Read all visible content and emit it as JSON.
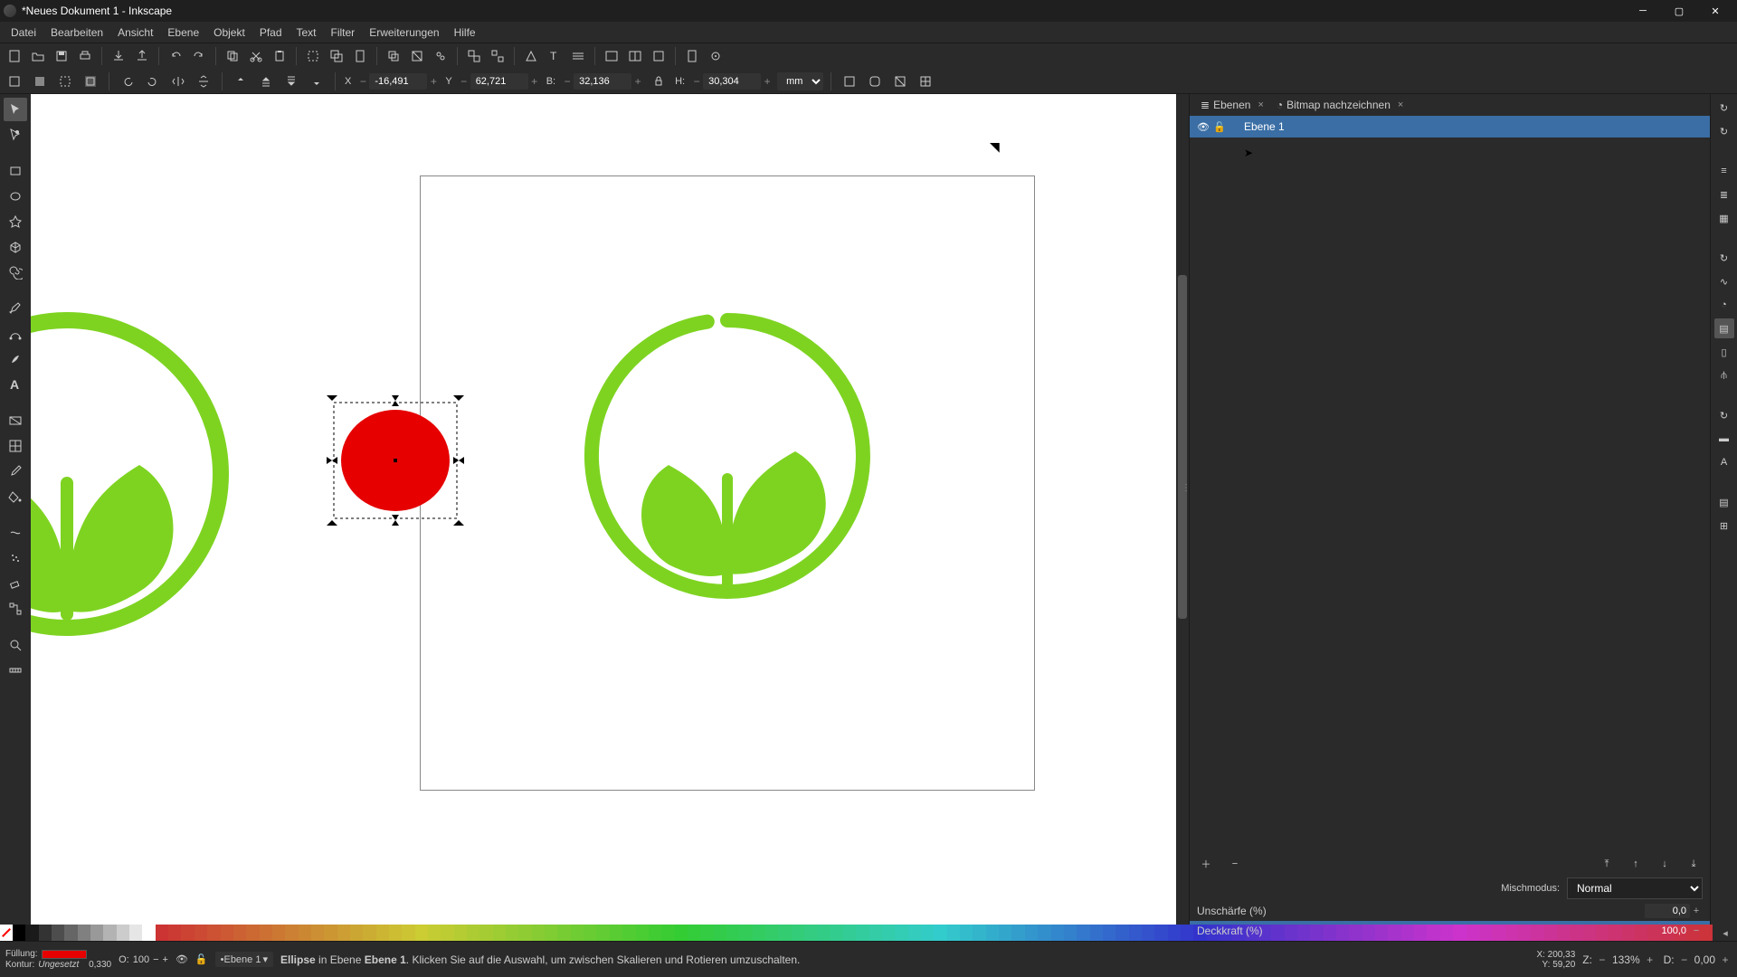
{
  "window": {
    "title": "*Neues Dokument 1 - Inkscape"
  },
  "menu": [
    "Datei",
    "Bearbeiten",
    "Ansicht",
    "Ebene",
    "Objekt",
    "Pfad",
    "Text",
    "Filter",
    "Erweiterungen",
    "Hilfe"
  ],
  "toolopts": {
    "x_label": "X",
    "x": "-16,491",
    "y_label": "Y",
    "y": "62,721",
    "w_label": "B:",
    "w": "32,136",
    "h_label": "H:",
    "h": "30,304",
    "unit": "mm"
  },
  "panels": {
    "tab1": "Ebenen",
    "tab2": "Bitmap nachzeichnen",
    "layer_name": "Ebene 1",
    "blend_label": "Mischmodus:",
    "blend_value": "Normal",
    "blur_label": "Unschärfe (%)",
    "blur_value": "0,0",
    "opacity_label": "Deckkraft (%)",
    "opacity_value": "100,0"
  },
  "status": {
    "fill_label": "Füllung:",
    "stroke_label": "Kontur:",
    "stroke_val": "Ungesetzt",
    "stroke_extra": "0,330",
    "o_label": "O:",
    "o_value": "100",
    "layer_indicator": "•Ebene 1",
    "selection_type": "Ellipse",
    "hint_prefix": "in Ebene",
    "hint_layer": "Ebene 1",
    "hint_rest": ". Klicken Sie auf die Auswahl, um zwischen Skalieren und Rotieren umzuschalten.",
    "coord_x_label": "X:",
    "coord_x": "200,33",
    "coord_y_label": "Y:",
    "coord_y": "59,20",
    "zoom_label": "Z:",
    "zoom": "133%",
    "rot_label": "D:",
    "rot": "0,00"
  },
  "colors": {
    "fill": "#e60000",
    "leaf": "#7ed321",
    "accent": "#3a6ea5"
  },
  "chart_data": null
}
